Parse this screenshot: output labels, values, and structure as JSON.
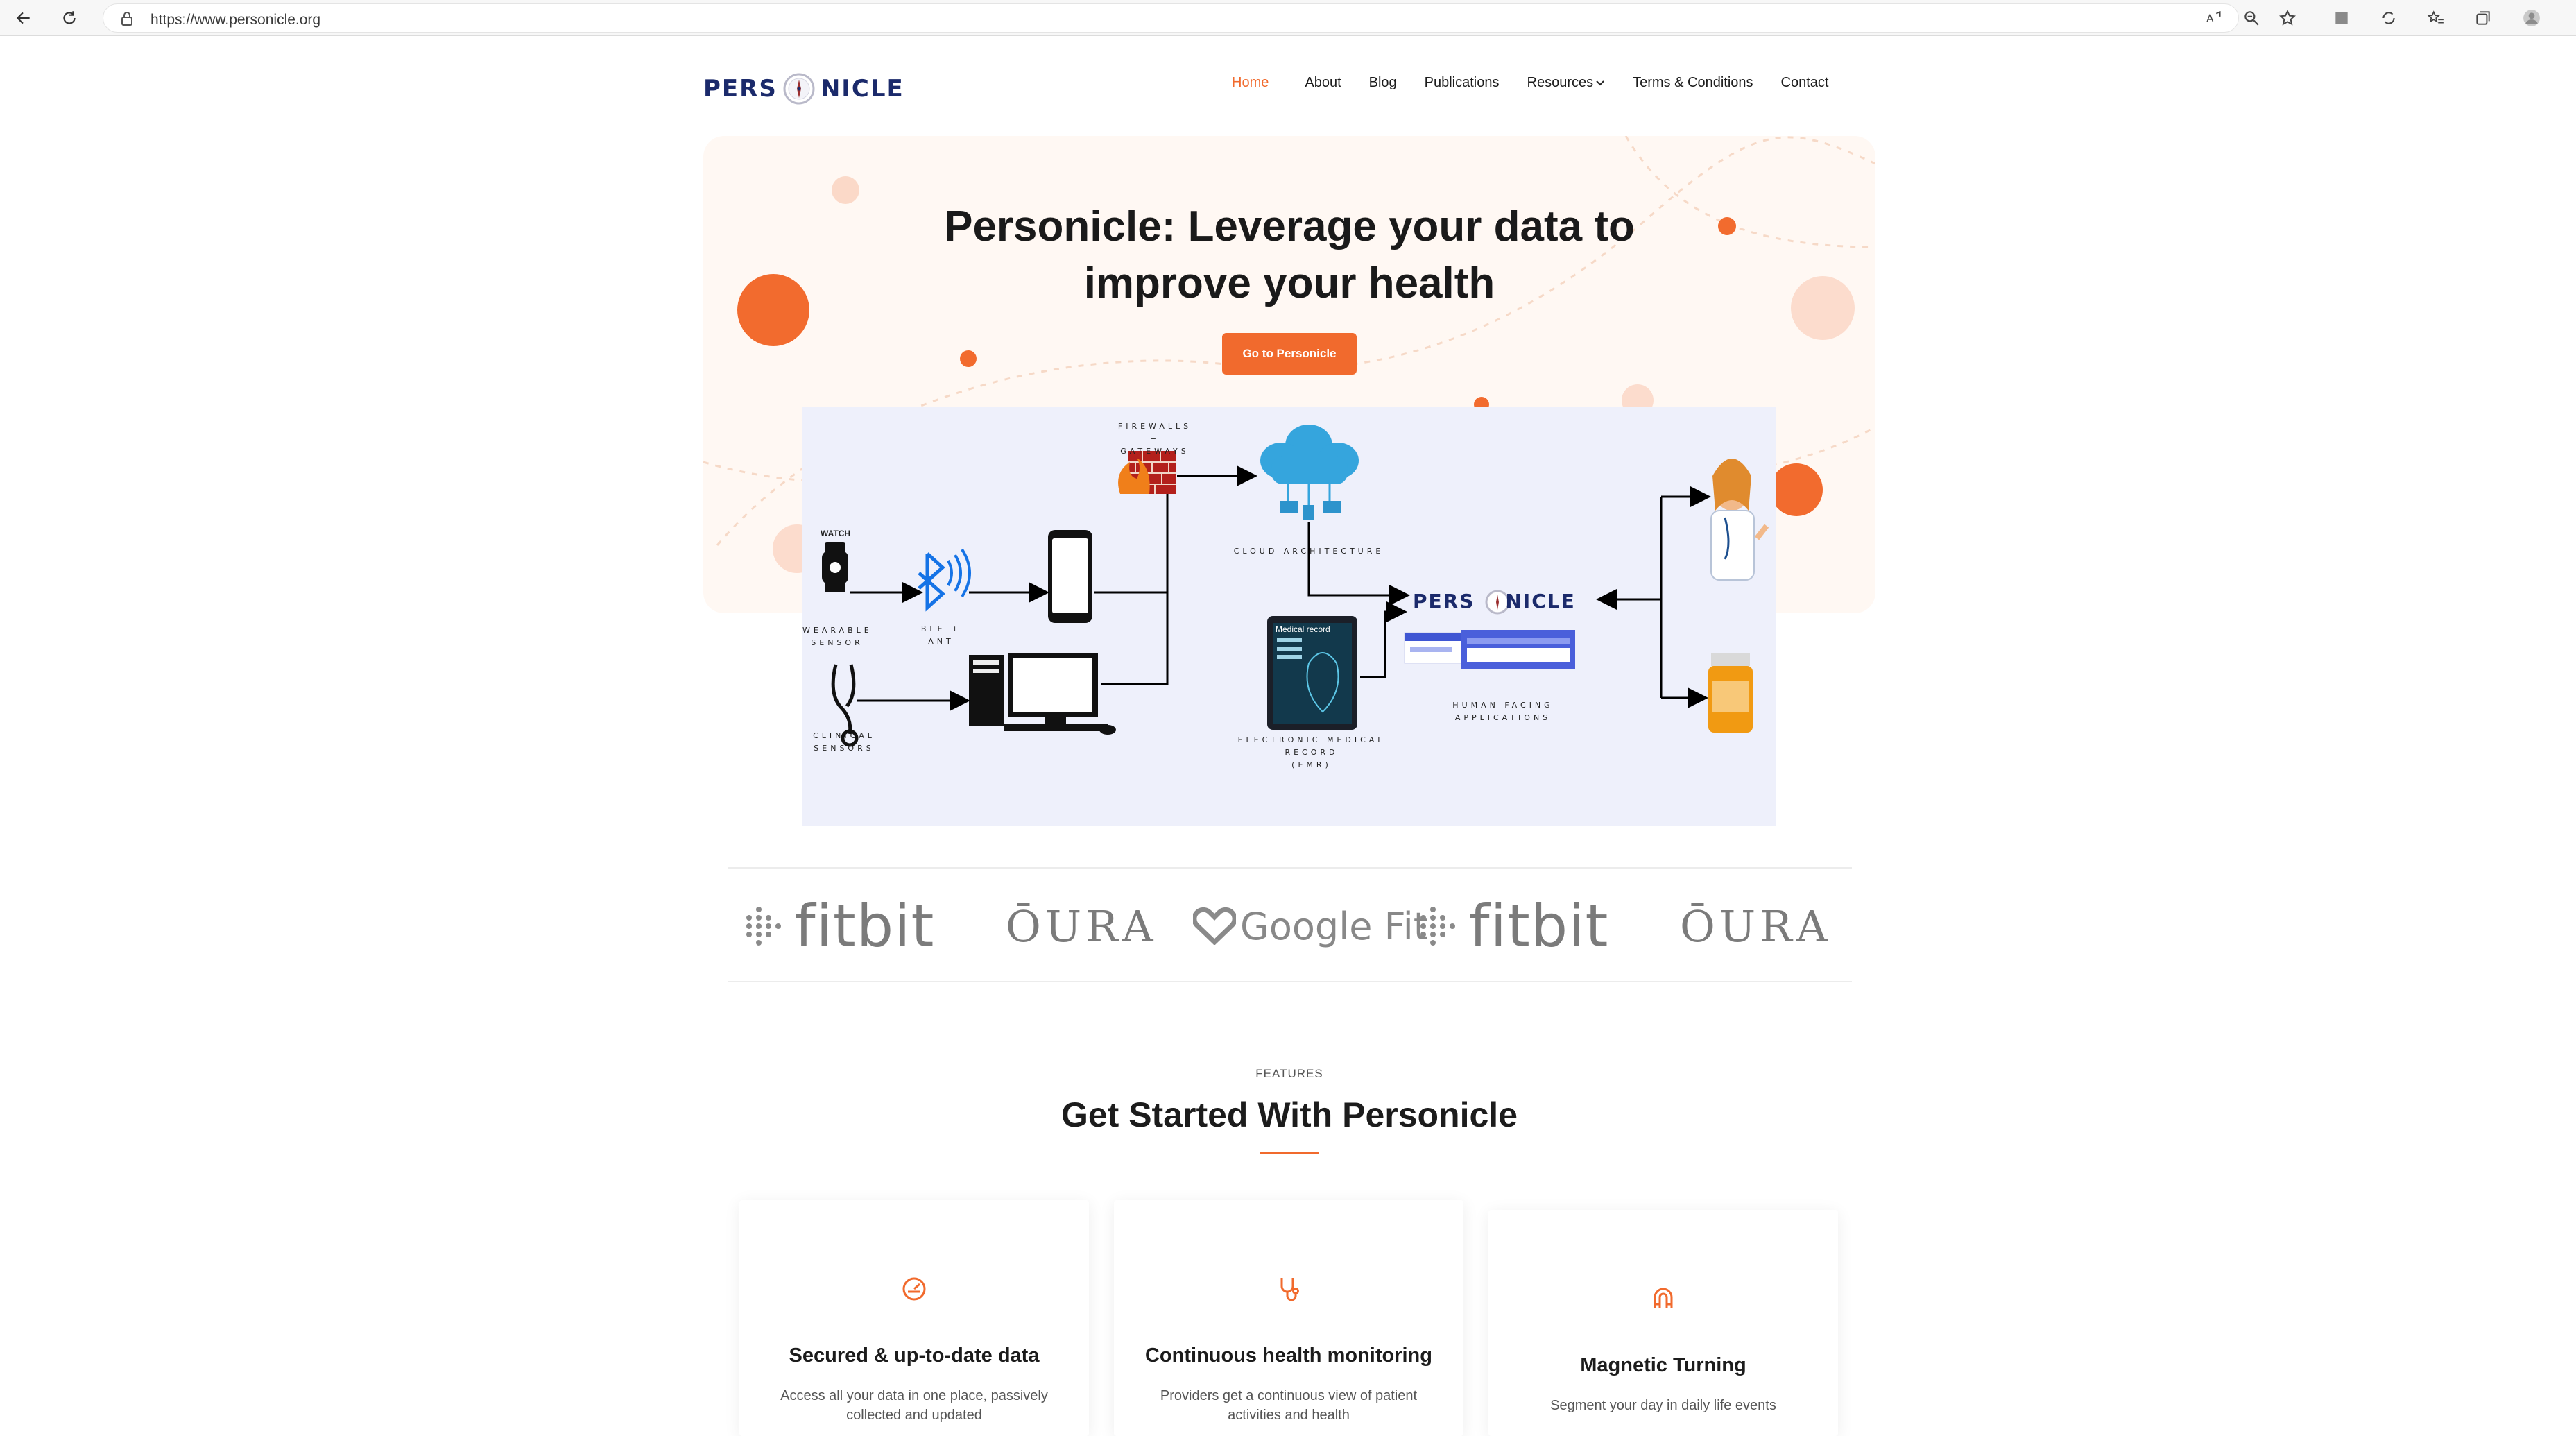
{
  "browser": {
    "url": "https://www.personicle.org"
  },
  "site": {
    "logo_left": "PERS",
    "logo_right": "NICLE",
    "nav": [
      {
        "label": "Home",
        "active": true
      },
      {
        "label": "About"
      },
      {
        "label": "Blog"
      },
      {
        "label": "Publications"
      },
      {
        "label": "Resources"
      },
      {
        "label": "Terms & Conditions"
      },
      {
        "label": "Contact"
      }
    ]
  },
  "hero": {
    "title_line1": "Personicle: Leverage your data to",
    "title_line2": "improve your health",
    "cta": "Go to Personicle"
  },
  "diagram": {
    "watch_badge": "WATCH",
    "firewalls": [
      "FIREWALLS +",
      "GATEWAYS"
    ],
    "cloud": "CLOUD ARCHITECTURE",
    "wearable": [
      "WEARABLE",
      "SENSOR"
    ],
    "ble": "BLE + ANT",
    "clinical": [
      "CLINICAL",
      "SENSORS"
    ],
    "medical_record": "Medical record",
    "emr": [
      "ELECTRONIC MEDICAL",
      "RECORD",
      "(EMR)"
    ],
    "personicle_left": "PERS",
    "personicle_right": "NICLE",
    "human_facing": [
      "HUMAN FACING",
      "APPLICATIONS"
    ]
  },
  "partners": [
    {
      "name": "fitbit",
      "icon": "fitbit-dots-icon"
    },
    {
      "name": "ŌURA"
    },
    {
      "name": "Google Fit",
      "icon": "google-fit-heart-icon"
    },
    {
      "name": "fitbit",
      "icon": "fitbit-dots-icon"
    },
    {
      "name": "ŌURA"
    }
  ],
  "features": {
    "eyebrow": "FEATURES",
    "title": "Get Started With Personicle",
    "cards": [
      {
        "icon": "speedometer-icon",
        "title": "Secured & up-to-date data",
        "text": "Access all your data in one place, passively collected and updated"
      },
      {
        "icon": "stethoscope-icon",
        "title": "Continuous health monitoring",
        "text": "Providers get a continuous view of patient activities and health"
      },
      {
        "icon": "magnet-icon",
        "title": "Magnetic Turning",
        "text": "Segment your day in daily life events"
      }
    ]
  },
  "colors": {
    "accent": "#f16a2d",
    "logo_navy": "#1b2a6b",
    "hero_bg": "#fff8f3",
    "diagram_bg": "#eef0fb"
  }
}
